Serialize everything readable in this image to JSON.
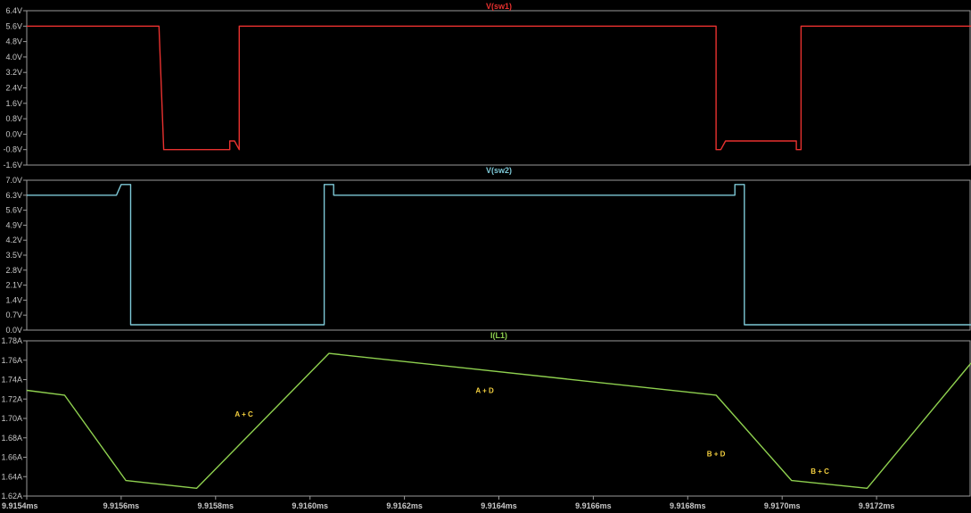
{
  "chart_data": [
    {
      "type": "line",
      "title": "V(sw1)",
      "color": "#e8312f",
      "ylim": [
        -1.6,
        6.4
      ],
      "yticks": [
        "6.4V",
        "5.6V",
        "4.8V",
        "4.0V",
        "3.2V",
        "2.4V",
        "1.6V",
        "0.8V",
        "0.0V",
        "-0.8V",
        "-1.6V"
      ],
      "ytick_values": [
        6.4,
        5.6,
        4.8,
        4.0,
        3.2,
        2.4,
        1.6,
        0.8,
        0.0,
        -0.8,
        -1.6
      ],
      "grid": false,
      "series": [
        {
          "x": [
            9.9154,
            9.91567,
            9.91568,
            9.91569,
            9.91569,
            9.91583,
            9.91583,
            9.91584,
            9.91585,
            9.91585,
            9.91686,
            9.91686,
            9.91687,
            9.91688,
            9.91688,
            9.91703,
            9.91703,
            9.91704,
            9.91704,
            9.9174
          ],
          "y": [
            5.6,
            5.6,
            5.6,
            -0.8,
            -0.8,
            -0.8,
            -0.35,
            -0.35,
            -0.8,
            5.6,
            5.6,
            -0.8,
            -0.8,
            -0.35,
            -0.35,
            -0.35,
            -0.8,
            -0.8,
            5.6,
            5.6
          ]
        }
      ]
    },
    {
      "type": "line",
      "title": "V(sw2)",
      "color": "#7dc8d6",
      "ylim": [
        0.0,
        7.0
      ],
      "yticks": [
        "7.0V",
        "6.3V",
        "5.6V",
        "4.9V",
        "4.2V",
        "3.5V",
        "2.8V",
        "2.1V",
        "1.4V",
        "0.7V",
        "0.0V"
      ],
      "ytick_values": [
        7.0,
        6.3,
        5.6,
        4.9,
        4.2,
        3.5,
        2.8,
        2.1,
        1.4,
        0.7,
        0.0
      ],
      "grid": false,
      "series": [
        {
          "x": [
            9.9154,
            9.91559,
            9.9156,
            9.91561,
            9.91562,
            9.91562,
            9.91603,
            9.91603,
            9.91604,
            9.91605,
            9.91605,
            9.9169,
            9.9169,
            9.91691,
            9.91692,
            9.91692,
            9.9174
          ],
          "y": [
            6.3,
            6.3,
            6.8,
            6.8,
            6.8,
            0.25,
            0.25,
            6.8,
            6.8,
            6.8,
            6.3,
            6.3,
            6.8,
            6.8,
            6.8,
            0.25,
            0.25
          ]
        }
      ]
    },
    {
      "type": "line",
      "title": "I(L1)",
      "color": "#8fd14f",
      "ylim": [
        1.62,
        1.78
      ],
      "yticks": [
        "1.78A",
        "1.76A",
        "1.74A",
        "1.72A",
        "1.70A",
        "1.68A",
        "1.66A",
        "1.64A",
        "1.62A"
      ],
      "ytick_values": [
        1.78,
        1.76,
        1.74,
        1.72,
        1.7,
        1.68,
        1.66,
        1.64,
        1.62
      ],
      "grid": false,
      "series": [
        {
          "x": [
            9.9154,
            9.91548,
            9.91561,
            9.91576,
            9.91604,
            9.91686,
            9.91702,
            9.91718,
            9.9174
          ],
          "y": [
            1.729,
            1.724,
            1.636,
            1.628,
            1.767,
            1.724,
            1.636,
            1.628,
            1.757
          ]
        }
      ],
      "annotations": [
        {
          "text": "A + C",
          "x": 9.91586,
          "y": 1.702
        },
        {
          "text": "A + D",
          "x": 9.91637,
          "y": 1.726
        },
        {
          "text": "B + D",
          "x": 9.91686,
          "y": 1.661
        },
        {
          "text": "B + C",
          "x": 9.91708,
          "y": 1.643
        }
      ]
    }
  ],
  "x_axis": {
    "xlim": [
      9.9154,
      9.9174
    ],
    "ticks": [
      "9.9154ms",
      "9.9156ms",
      "9.9158ms",
      "9.9160ms",
      "9.9162ms",
      "9.9164ms",
      "9.9166ms",
      "9.9168ms",
      "9.9170ms",
      "9.9172ms"
    ],
    "tick_values": [
      9.9154,
      9.9156,
      9.9158,
      9.916,
      9.9162,
      9.9164,
      9.9166,
      9.9168,
      9.917,
      9.9172
    ]
  }
}
